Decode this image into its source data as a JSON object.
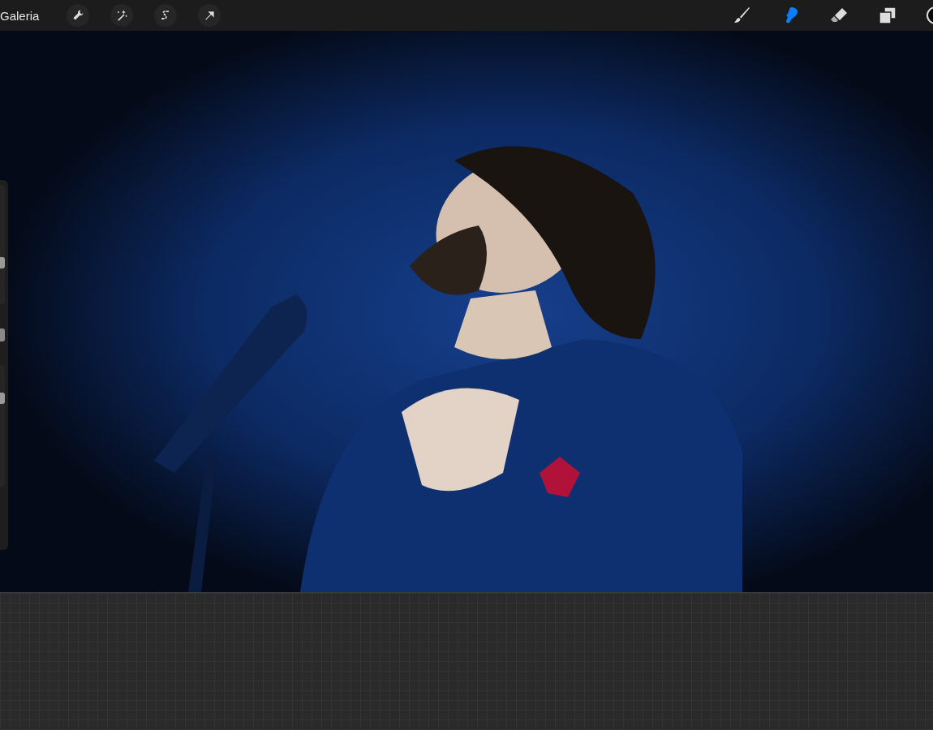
{
  "top_bar": {
    "gallery": "Galeria",
    "actions": [
      {
        "kind": "wrench"
      },
      {
        "kind": "wand"
      },
      {
        "kind": "selection"
      },
      {
        "kind": "transform"
      }
    ],
    "tools": [
      {
        "kind": "brush",
        "selected": false
      },
      {
        "kind": "smudge",
        "selected": true
      },
      {
        "kind": "eraser",
        "selected": false
      },
      {
        "kind": "layers",
        "selected": false
      }
    ],
    "color_swatch": {
      "color": "#0a0a0a"
    }
  },
  "sidebar": {
    "size_slider": {
      "level": 0.35
    },
    "opacity_slider": {
      "level": 0.73
    }
  }
}
